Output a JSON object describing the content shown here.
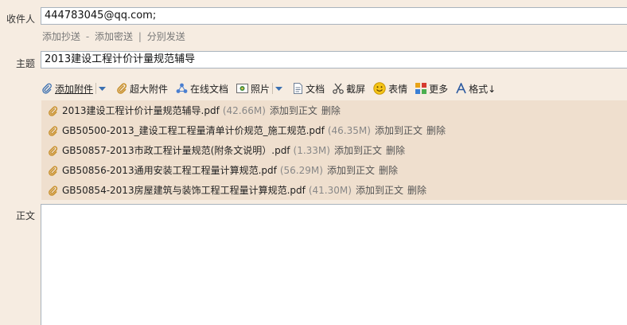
{
  "to": {
    "label": "收件人",
    "value": "444783045@qq.com;",
    "links": {
      "cc": "添加抄送",
      "dash": "-",
      "bcc": "添加密送",
      "bar": "|",
      "separate": "分别发送"
    }
  },
  "subject": {
    "label": "主题",
    "value": "2013建设工程计价计量规范辅导"
  },
  "toolbar": {
    "add_attachment": "添加附件",
    "large_attachment": "超大附件",
    "online_docs": "在线文档",
    "photos": "照片",
    "documents": "文档",
    "screenshot": "截屏",
    "emoji": "表情",
    "more": "更多",
    "format": "格式↓"
  },
  "attachments": [
    {
      "name": "2013建设工程计价计量规范辅导.pdf",
      "size": "(42.66M)",
      "add_to_body": "添加到正文",
      "delete": "删除"
    },
    {
      "name": "GB50500-2013_建设工程工程量清单计价规范_施工规范.pdf",
      "size": "(46.35M)",
      "add_to_body": "添加到正文",
      "delete": "删除"
    },
    {
      "name": "GB50857-2013市政工程计量规范(附条文说明）.pdf",
      "size": "(1.33M)",
      "add_to_body": "添加到正文",
      "delete": "删除"
    },
    {
      "name": "GB50856-2013通用安装工程工程量计算规范.pdf",
      "size": "(56.29M)",
      "add_to_body": "添加到正文",
      "delete": "删除"
    },
    {
      "name": "GB50854-2013房屋建筑与装饰工程工程量计算规范.pdf",
      "size": "(41.30M)",
      "add_to_body": "添加到正文",
      "delete": "删除"
    }
  ],
  "body": {
    "label": "正文",
    "value": ""
  },
  "colors": {
    "background": "#f6ece1",
    "attachment_bg": "#efdfce",
    "border": "#a9b3bd"
  },
  "icons": [
    "paperclip-icon",
    "large-attachment-icon",
    "online-docs-icon",
    "photo-icon",
    "document-icon",
    "scissors-icon",
    "smiley-icon",
    "more-apps-icon",
    "format-icon",
    "chevron-down-icon"
  ]
}
